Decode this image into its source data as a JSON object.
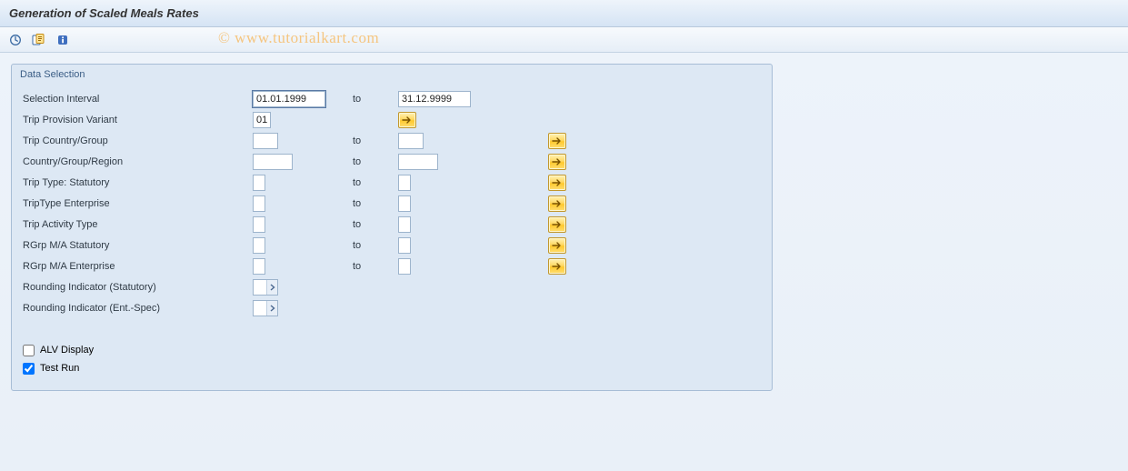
{
  "title": "Generation of Scaled Meals Rates",
  "watermark": "© www.tutorialkart.com",
  "group": {
    "title": "Data Selection",
    "rows": {
      "selection_interval": {
        "label": "Selection Interval",
        "from": "01.01.1999",
        "to_label": "to",
        "to": "31.12.9999"
      },
      "trip_provision_variant": {
        "label": "Trip Provision Variant",
        "from": "01"
      },
      "trip_country_group": {
        "label": "Trip Country/Group",
        "from": "",
        "to_label": "to",
        "to": ""
      },
      "country_group_region": {
        "label": "Country/Group/Region",
        "from": "",
        "to_label": "to",
        "to": ""
      },
      "trip_type_statutory": {
        "label": "Trip Type: Statutory",
        "from": "",
        "to_label": "to",
        "to": ""
      },
      "trip_type_enterprise": {
        "label": "TripType Enterprise",
        "from": "",
        "to_label": "to",
        "to": ""
      },
      "trip_activity_type": {
        "label": "Trip Activity Type",
        "from": "",
        "to_label": "to",
        "to": ""
      },
      "rgrp_ma_statutory": {
        "label": "RGrp M/A Statutory",
        "from": "",
        "to_label": "to",
        "to": ""
      },
      "rgrp_ma_enterprise": {
        "label": "RGrp M/A Enterprise",
        "from": "",
        "to_label": "to",
        "to": ""
      },
      "rounding_statutory": {
        "label": "Rounding Indicator (Statutory)",
        "from": ""
      },
      "rounding_entspec": {
        "label": "Rounding Indicator (Ent.-Spec)",
        "from": ""
      }
    },
    "checkboxes": {
      "alv_display": {
        "label": "ALV Display",
        "checked": false
      },
      "test_run": {
        "label": "Test Run",
        "checked": true
      }
    }
  }
}
